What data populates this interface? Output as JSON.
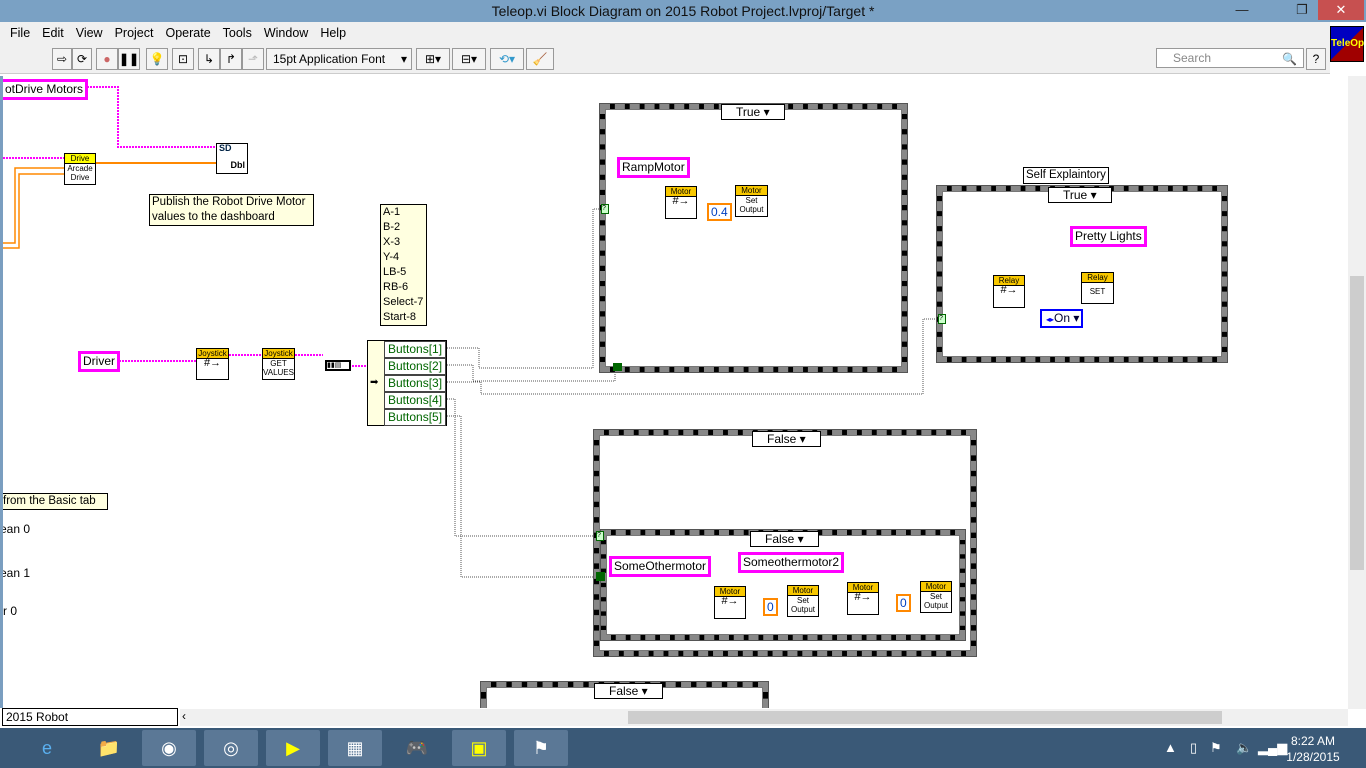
{
  "window": {
    "title": "Teleop.vi Block Diagram on 2015 Robot Project.lvproj/Target *",
    "minimize": "—",
    "restore": "❐",
    "close": "✕"
  },
  "menu": [
    "File",
    "Edit",
    "View",
    "Project",
    "Operate",
    "Tools",
    "Window",
    "Help"
  ],
  "toolbar": {
    "font": "15pt Application Font",
    "search_placeholder": "Search",
    "help": "?",
    "vi_icon": "TeleOp"
  },
  "diagram": {
    "drive_motors": "otDrive Motors",
    "drive_hd": "Drive",
    "drive_body": "Arcade Drive",
    "sd_top": "SD",
    "sd_bottom": "Dbl",
    "publish_comment": "Publish the Robot Drive Motor values to the dashboard",
    "legend": [
      "A-1",
      "B-2",
      "X-3",
      "Y-4",
      "LB-5",
      "RB-6",
      "Select-7",
      "Start-8"
    ],
    "driver": "Driver",
    "joystick_hd": "Joystick",
    "joystick2_hd": "Joystick",
    "joystick2_body": "GET VALUES",
    "buttons": [
      "Buttons[1]",
      "Buttons[2]",
      "Buttons[3]",
      "Buttons[4]",
      "Buttons[5]"
    ],
    "case1_sel": "True",
    "ramp_motor": "RampMotor",
    "motor": "Motor",
    "set_output": "Set Output",
    "ramp_value": "0.4",
    "case2_label": "Self Explaintory",
    "case2_sel": "True",
    "pretty_lights": "Pretty Lights",
    "relay": "Relay",
    "relay_set": "SET",
    "relay_value": "On",
    "case3_sel": "False",
    "case4_sel": "False",
    "some_other": "SomeOthermotor",
    "some_other2": "Someothermotor2",
    "zero1": "0",
    "zero2": "0",
    "case5_sel": "False",
    "basic_comment": "from the Basic tab",
    "left_1": "ean 0",
    "left_2": "ean 1",
    "left_3": "r 0",
    "path": "2015 Robot Project.lvproj/Target"
  },
  "taskbar": {
    "time": "8:22 AM",
    "date": "1/28/2015",
    "apps": [
      "internet-explorer",
      "file-explorer",
      "chrome",
      "app-4",
      "labview",
      "control-panel",
      "driver-station",
      "labview-2",
      "frc-dashboard"
    ]
  },
  "colors": {
    "refnum": "#ff00ff",
    "numeric": "#ff8000",
    "boolean": "#006000",
    "titlebar": "#7aa1c4",
    "taskbar": "#3a5977"
  }
}
